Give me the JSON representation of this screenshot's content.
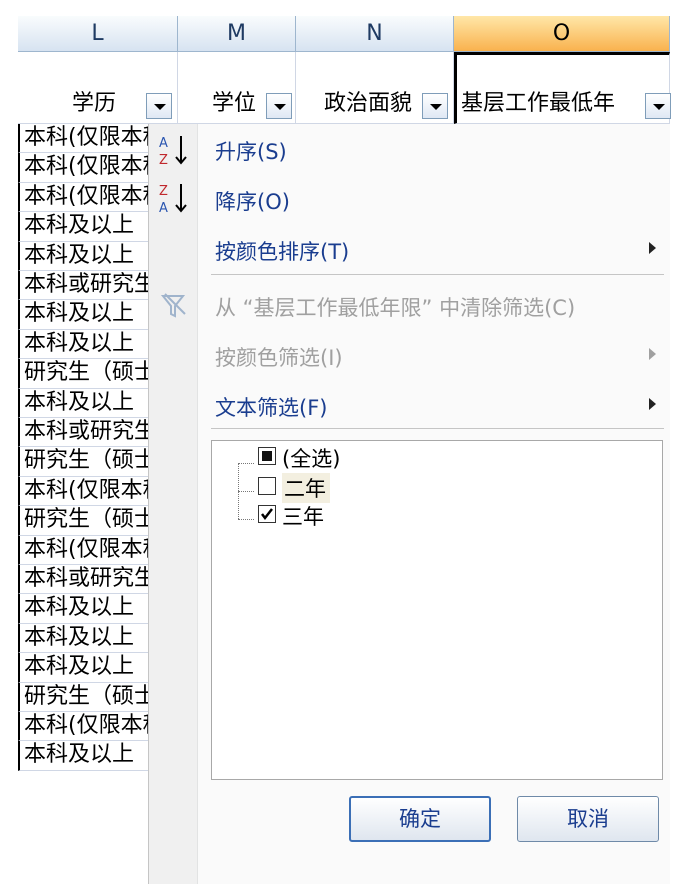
{
  "column_letters": [
    "L",
    "M",
    "N",
    "O"
  ],
  "header_cells": [
    "学历",
    "学位",
    "政治面貌",
    "基层工作最低年"
  ],
  "column_L_values": [
    "本科(仅限本科)",
    "本科(仅限本科)",
    "本科(仅限本科)",
    "本科及以上",
    "本科及以上",
    "本科或研究生",
    "本科及以上",
    "本科及以上",
    "研究生（硕士）",
    "本科及以上",
    "本科或研究生",
    "研究生（硕士）",
    "本科(仅限本科)",
    "研究生（硕士）",
    "本科(仅限本科)",
    "本科或研究生",
    "本科及以上",
    "本科及以上",
    "本科及以上",
    "研究生（硕士）",
    "本科(仅限本科)",
    "本科及以上"
  ],
  "menu": {
    "sort_asc": "升序(S)",
    "sort_desc": "降序(O)",
    "sort_by_color": "按颜色排序(T)",
    "clear_filter": "从 “基层工作最低年限” 中清除筛选(C)",
    "filter_by_color": "按颜色筛选(I)",
    "text_filter": "文本筛选(F)"
  },
  "filter_list": {
    "select_all": "(全选)",
    "items": [
      {
        "label": "二年",
        "checked": false
      },
      {
        "label": "三年",
        "checked": true
      }
    ]
  },
  "buttons": {
    "ok": "确定",
    "cancel": "取消"
  },
  "icons": {
    "sort_asc": "sort-ascending-icon",
    "sort_desc": "sort-descending-icon",
    "clear_filter": "clear-filter-icon"
  }
}
